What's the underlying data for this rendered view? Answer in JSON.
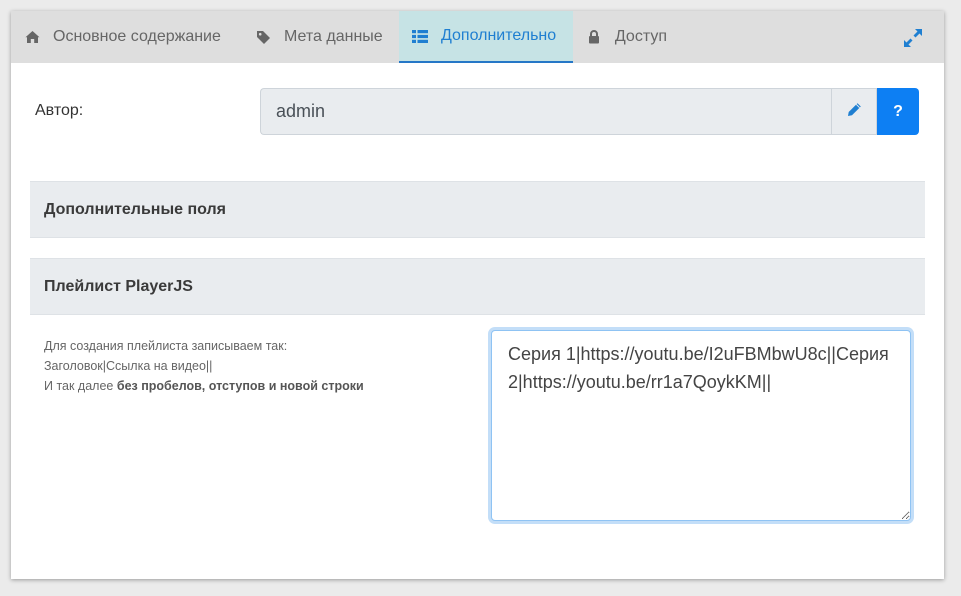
{
  "tabs": [
    {
      "label": "Основное содержание",
      "icon": "home-icon",
      "active": false
    },
    {
      "label": "Мета данные",
      "icon": "tag-icon",
      "active": false
    },
    {
      "label": "Дополнительно",
      "icon": "list-icon",
      "active": true
    },
    {
      "label": "Доступ",
      "icon": "lock-icon",
      "active": false
    }
  ],
  "author": {
    "label": "Автор:",
    "value": "admin",
    "edit_icon": "pencil-icon",
    "help_label": "?"
  },
  "sections": {
    "extra_fields": "Дополнительные поля",
    "playlist_title": "Плейлист PlayerJS"
  },
  "help": {
    "line1": "Для создания плейлиста записываем так:",
    "line2": "Заголовок|Ссылка на видео||",
    "line3_plain": "И так далее ",
    "line3_bold": "без пробелов, отступов и новой строки"
  },
  "playlist": {
    "value": "Серия 1|https://youtu.be/I2uFBMbwU8c||Серия 2|https://youtu.be/rr1a7QoykKM||"
  },
  "colors": {
    "accent": "#0d7ff3",
    "active_tab_bg": "#c6e3e5",
    "tabbar_bg": "#dedede"
  }
}
